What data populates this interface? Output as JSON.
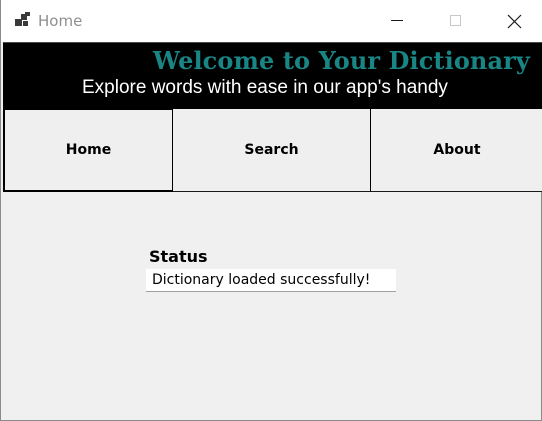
{
  "window": {
    "title": "Home",
    "app_icon": "app-window-icon",
    "controls": {
      "minimize_icon": "minimize-icon",
      "maximize_icon": "maximize-icon",
      "close_icon": "close-icon"
    }
  },
  "banner": {
    "title": "Welcome to Your Dictionary",
    "subtitle": "Explore words with ease in our app's handy",
    "title_color": "#1a8585",
    "background": "#000000"
  },
  "nav": {
    "items": [
      {
        "label": "Home",
        "active": true
      },
      {
        "label": "Search",
        "active": false
      },
      {
        "label": "About",
        "active": false
      }
    ]
  },
  "status": {
    "label": "Status",
    "value": "Dictionary loaded successfully!"
  }
}
